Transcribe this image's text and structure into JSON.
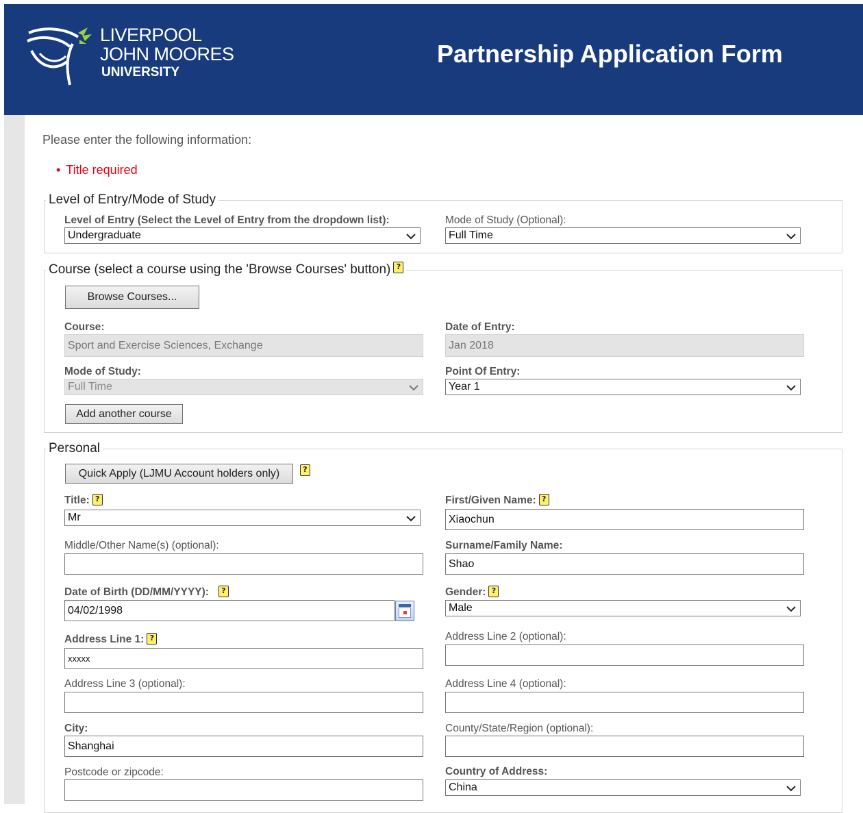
{
  "header": {
    "logo_line1": "LIVERPOOL",
    "logo_line2": "JOHN MOORES",
    "logo_line3": "UNIVERSITY",
    "title": "Partnership Application Form"
  },
  "intro_text": "Please enter the following information:",
  "errors": [
    "Title required"
  ],
  "level_section": {
    "legend": "Level of Entry/Mode of Study",
    "level_label": "Level of Entry (Select the Level of Entry from the dropdown list):",
    "level_value": "Undergraduate",
    "mode_label": "Mode of Study (Optional):",
    "mode_value": "Full Time"
  },
  "course_section": {
    "legend": "Course (select a course using the 'Browse Courses' button)",
    "browse_button": "Browse Courses...",
    "course_label": "Course:",
    "course_value": "Sport and Exercise Sciences, Exchange",
    "date_label": "Date of Entry:",
    "date_value": "Jan 2018",
    "mode_label": "Mode of Study:",
    "mode_value": "Full Time",
    "point_label": "Point Of Entry:",
    "point_value": "Year 1",
    "add_button": "Add another course"
  },
  "personal_section": {
    "legend": "Personal",
    "quick_apply": "Quick Apply (LJMU Account holders only)",
    "title_label": "Title:",
    "title_value": "Mr",
    "first_label": "First/Given Name:",
    "first_value": "Xiaochun",
    "middle_label": "Middle/Other Name(s) (optional):",
    "middle_value": "",
    "surname_label": "Surname/Family Name:",
    "surname_value": "Shao",
    "dob_label": "Date of Birth (DD/MM/YYYY):",
    "dob_value": "04/02/1998",
    "gender_label": "Gender:",
    "gender_value": "Male",
    "addr1_label": "Address Line 1:",
    "addr1_value": "xxxxx",
    "addr2_label": "Address Line 2 (optional):",
    "addr2_value": "",
    "addr3_label": "Address Line 3 (optional):",
    "addr3_value": "",
    "addr4_label": "Address Line 4 (optional):",
    "addr4_value": "",
    "city_label": "City:",
    "city_value": "Shanghai",
    "county_label": "County/State/Region (optional):",
    "county_value": "",
    "postcode_label": "Postcode or zipcode:",
    "postcode_value": "",
    "country_label": "Country of Address:",
    "country_value": "China"
  },
  "icons": {
    "help": "?",
    "chevron": "❯",
    "bullet": "•"
  },
  "colors": {
    "header_bg": "#183b7e",
    "error": "#e3000f",
    "help_icon": "#ffef6a"
  }
}
